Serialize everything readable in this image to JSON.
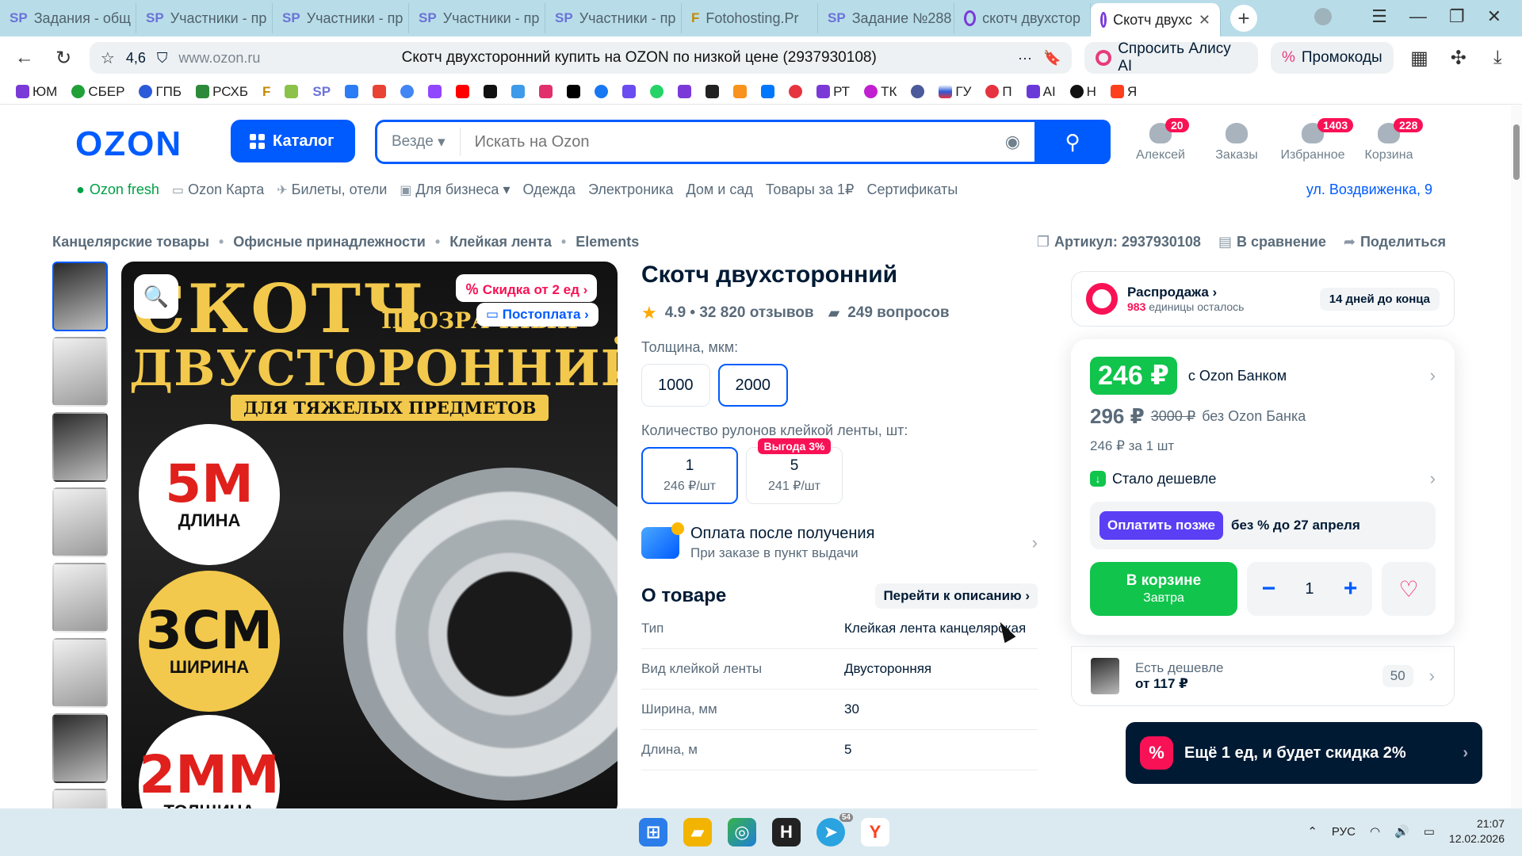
{
  "browser": {
    "tabs": [
      {
        "icon": "SP",
        "label": "Задания - общ"
      },
      {
        "icon": "SP",
        "label": "Участники - пр"
      },
      {
        "icon": "SP",
        "label": "Участники - пр"
      },
      {
        "icon": "SP",
        "label": "Участники - пр"
      },
      {
        "icon": "SP",
        "label": "Участники - пр"
      },
      {
        "icon": "F",
        "label": "Fotohosting.Pr"
      },
      {
        "icon": "SP",
        "label": "Задание №288"
      },
      {
        "icon": "O",
        "label": "скотч двухстор"
      },
      {
        "icon": "O",
        "label": "Скотч двухс"
      }
    ],
    "rating": "4,6",
    "host": "www.ozon.ru",
    "page_title": "Скотч двухсторонний купить на OZON по низкой цене (2937930108)",
    "alisa": "Спросить Алису AI",
    "promo": "Промокоды",
    "bookmarks": [
      "ЮМ",
      "СБЕР",
      "ГПБ",
      "РСХБ",
      "F",
      "SP",
      "РТ",
      "ТК",
      "ГУ",
      "П",
      "AI",
      "Н",
      "Я"
    ]
  },
  "header": {
    "logo": "OZON",
    "catalog": "Каталог",
    "search_scope": "Везде",
    "search_placeholder": "Искать на Ozon",
    "icons": [
      {
        "label": "Алексей",
        "badge": "20"
      },
      {
        "label": "Заказы",
        "badge": ""
      },
      {
        "label": "Избранное",
        "badge": "1403"
      },
      {
        "label": "Корзина",
        "badge": "228"
      }
    ],
    "menu": [
      "Ozon fresh",
      "Ozon Карта",
      "Билеты, отели",
      "Для бизнеса",
      "Одежда",
      "Электроника",
      "Дом и сад",
      "Товары за 1₽",
      "Сертификаты"
    ],
    "address": "ул. Воздвиженка, 9"
  },
  "breadcrumbs": [
    "Канцелярские товары",
    "Офисные принадлежности",
    "Клейкая лента",
    "Elements"
  ],
  "meta": {
    "article": "Артикул: 2937930108",
    "compare": "В сравнение",
    "share": "Поделиться"
  },
  "gallery": {
    "h1": "СКОТЧ",
    "h1s": "ПРОЗРАЧНЫЙ",
    "h2": "ДВУСТОРОННИЙ",
    "strip": "ДЛЯ ТЯЖЕЛЫХ ПРЕДМЕТОВ",
    "c1_big": "5М",
    "c1_sm": "ДЛИНА",
    "c2_big": "3СМ",
    "c2_sm": "ШИРИНА",
    "c3_big": "2ММ",
    "c3_sm": "ТОЛЩИНА",
    "chip_discount": "Скидка от 2 ед",
    "chip_postpay": "Постоплата"
  },
  "product": {
    "title": "Скотч двухсторонний",
    "rating": "4.9 • 32 820 отзывов",
    "questions": "249 вопросов",
    "thickness_label": "Толщина, мкм:",
    "thickness": [
      "1000",
      "2000"
    ],
    "rolls_label": "Количество рулонов клейкой ленты, шт:",
    "rolls": [
      {
        "n": "1",
        "p": "246 ₽/шт",
        "badge": ""
      },
      {
        "n": "5",
        "p": "241 ₽/шт",
        "badge": "Выгода 3%"
      }
    ],
    "pay_title": "Оплата после получения",
    "pay_sub": "При заказе в пункт выдачи",
    "about": "О товаре",
    "to_desc": "Перейти к описанию",
    "specs": [
      {
        "k": "Тип",
        "v": "Клейкая лента канцелярская"
      },
      {
        "k": "Вид клейкой ленты",
        "v": "Двусторонняя"
      },
      {
        "k": "Ширина, мм",
        "v": "30"
      },
      {
        "k": "Длина, м",
        "v": "5"
      }
    ]
  },
  "buybox": {
    "sale_title": "Распродажа",
    "sale_left_num": "983",
    "sale_left": "единицы осталось",
    "sale_days": "14 дней до конца",
    "price_bank": "246 ₽",
    "price_bank_label": "с Ozon Банком",
    "price": "296 ₽",
    "price_old": "3000 ₽",
    "price_label": "без Ozon Банка",
    "per_unit": "246 ₽ за 1 шт",
    "cheaper": "Стало дешевле",
    "pay_later": "Оплатить позже",
    "pay_later_desc": "без % до 27 апреля",
    "in_cart": "В корзине",
    "in_cart_sub": "Завтра",
    "qty": "1",
    "cheaper2": "Есть дешевле",
    "cheaper2_price": "от 117 ₽",
    "cheaper2_count": "50"
  },
  "toast": "Ещё 1 ед, и будет скидка 2%",
  "taskbar": {
    "lang": "РУС",
    "time": "21:07",
    "date": "12.02.2026",
    "tg_badge": "54"
  }
}
